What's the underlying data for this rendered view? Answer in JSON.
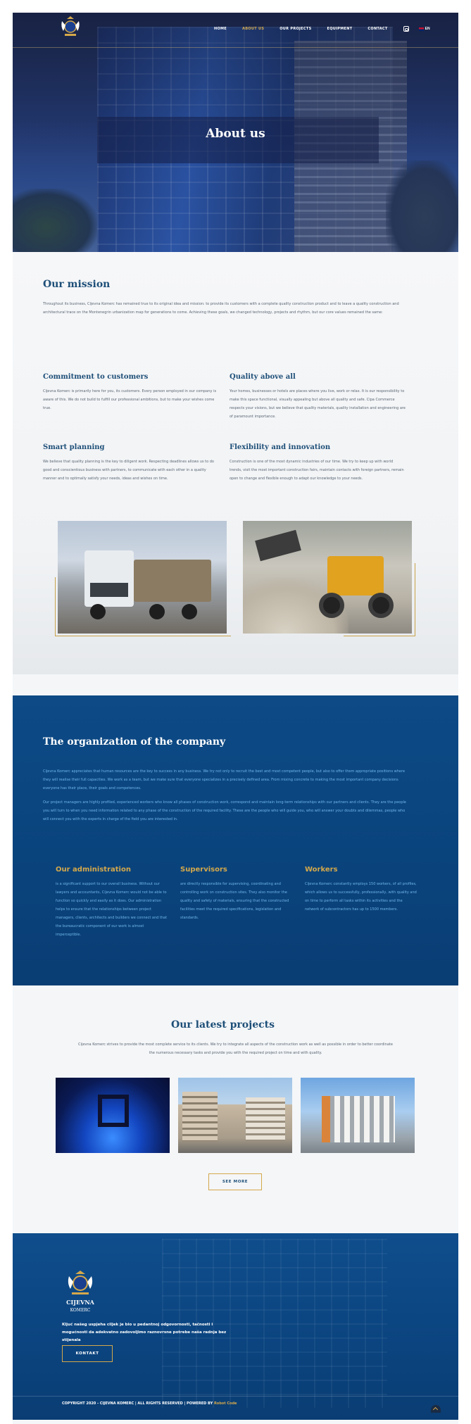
{
  "nav": {
    "items": [
      {
        "label": "HOME",
        "active": false
      },
      {
        "label": "ABOUT US",
        "active": true
      },
      {
        "label": "OUR PROJECTS",
        "active": false
      },
      {
        "label": "EQUIPMENT",
        "active": false
      },
      {
        "label": "CONTACT",
        "active": false
      }
    ],
    "instagram_icon": "instagram-icon",
    "language": "EN"
  },
  "hero": {
    "title": "About us"
  },
  "mission": {
    "title": "Our mission",
    "text": "Throughout its business, Cijevna Komerc has remained true to its original idea and mission: to provide its customers with a complete quality construction product and to leave a quality construction and architectural trace on the Montenegrin urbanization map for generations to come. Achieving these goals, we changed technology, projects and rhythm, but our core values remained the same:"
  },
  "features": [
    {
      "title": "Commitment to customers",
      "text": "Cijevna Komerc is primarily here for you, its customers. Every person employed in our company is aware of this. We do not build to fulfill our professional ambitions, but to make your wishes come true."
    },
    {
      "title": "Quality above all",
      "text": "Your homes, businesses or hotels are places where you live, work or relax. It is our responsibility to make this space functional, visually appealing but above all quality and safe. Cipa Commerce respects your visions, but we believe that quality materials, quality installation and engineering are of paramount importance."
    },
    {
      "title": "Smart planning",
      "text": "We believe that quality planning is the key to diligent work. Respecting deadlines allows us to do good and conscientious business with partners, to communicate with each other in a quality manner and to optimally satisfy your needs, ideas and wishes on time."
    },
    {
      "title": "Flexibility and innovation",
      "text": "Construction is one of the most dynamic industries of our time. We try to keep up with world trends, visit the most important construction fairs, maintain contacts with foreign partners, remain open to change and flexible enough to adapt our knowledge to your needs."
    }
  ],
  "organization": {
    "title": "The organization of the company",
    "p1": "Cijevna Komerc appreciates that human resources are the key to success in any business. We try not only to recruit the best and most competent people, but also to offer them appropriate positions where they will realise their full capacities. We work as a team, but we make sure that everyone specializes in a precisely defined area. From mixing concrete to making the most important company decisions everyone has their place, their goals and competences.",
    "p2": "Our project managers are highly profiled, experienced workers who know all phases of construction work, correspond and maintain long-term relationships with our partners and clients. They are the people you will turn to when you need information related to any phase of the construction of the required facility. These are the people who will guide you, who will answer your doubts and dilemmas, people who will connect you with the experts in charge of the field you are interested in.",
    "columns": [
      {
        "title": "Our administration",
        "text": "is a significant support to our overall business. Without our lawyers and accountants, Cijevna Komerc would not be able to function so quickly and easily as it does. Our administration helps to ensure that the relationships between project managers, clients, architects and builders we connect and that the bureaucratic component of our work is almost imperceptible."
      },
      {
        "title": "Supervisors",
        "text": "are directly responsible for supervising, coordinating and controlling work on construction sites. They also monitor the quality and safety of materials, ensuring that the constructed facilities meet the required specifications, legislation and standards."
      },
      {
        "title": "Workers",
        "text": "Cijevna Komerc constantly employs 150 workers, of all profiles, which allows us to successfully, professionally, with quality and on time to perform all tasks within its activities and the network of subcontractors has up to 1500 members."
      }
    ]
  },
  "projects": {
    "title": "Our latest projects",
    "text": "Cijevna Komerc strives to provide the most complete service to its clients. We try to integrate all aspects of the construction work as well as possible in order to better coordinate the numerous necessary tasks and provide you with the required project on time and with quality.",
    "see_more": "SEE MORE"
  },
  "footer": {
    "logo_text": "CIJEVNA KOMERC",
    "text": "Kljuć našeg uspjeha ciljek je bio u pedantnoj odgovornosti, tačnosti i mogućnosti da adekvatno zadovoljimo raznovrsne potrebe naša radnja bez stijenala",
    "button": "KONTAKT",
    "copyright": "COPYRIGHT 2020 - CIJEVNA KOMERC  |  ALL RIGHTS RESERVED  |  POWERED BY ",
    "powered_by": "Robot Code"
  },
  "colors": {
    "accent_gold": "#d4a84b",
    "primary_blue": "#1e4f78",
    "org_blue": "#0d4a86",
    "link_blue": "#6fb6ea"
  }
}
